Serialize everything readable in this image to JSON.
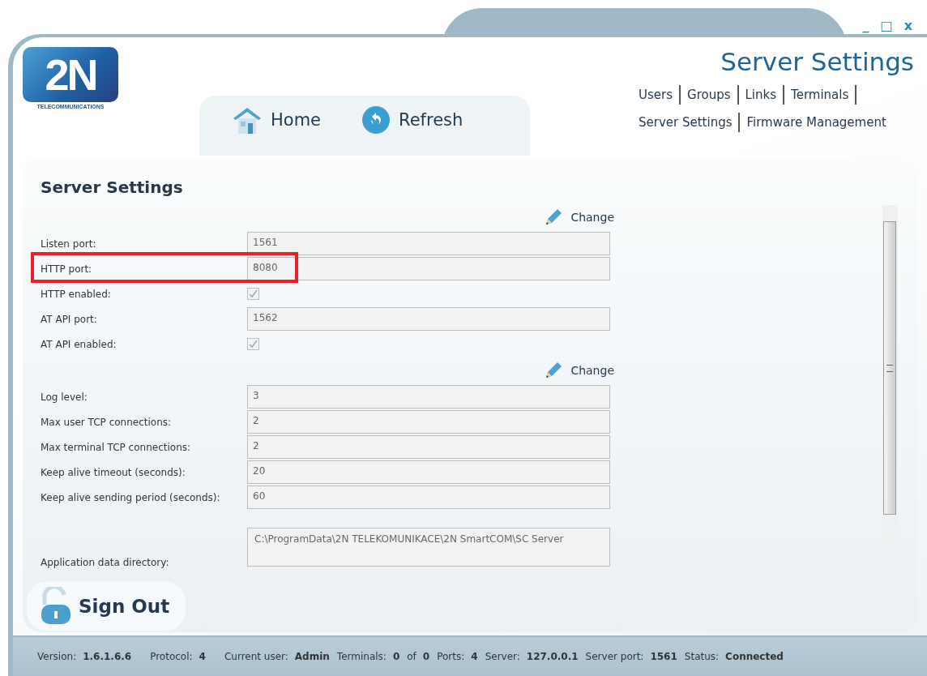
{
  "window": {
    "controls": [
      "_",
      "□",
      "x"
    ]
  },
  "logo": {
    "mark": "2N",
    "tagline": "TELECOMMUNICATIONS"
  },
  "toolbar": [
    {
      "label": "Home",
      "kind": "home"
    },
    {
      "label": "Refresh",
      "kind": "refresh"
    }
  ],
  "header": {
    "title": "Server Settings"
  },
  "nav": [
    [
      {
        "label": "Users"
      },
      {
        "label": "Groups"
      },
      {
        "label": "Links"
      },
      {
        "label": "Terminals"
      }
    ],
    [
      {
        "label": "Server Settings"
      },
      {
        "label": "Firmware Management"
      }
    ]
  ],
  "panel": {
    "title": "Server Settings",
    "sections": [
      {
        "action": "Change",
        "fields": [
          {
            "label": "Listen port:",
            "kind": "text",
            "value": "1561",
            "highlighted": false
          },
          {
            "label": "HTTP port:",
            "kind": "text",
            "value": "8080",
            "highlighted": true
          },
          {
            "label": "HTTP enabled:",
            "kind": "checkbox",
            "checked": true,
            "highlighted": false
          },
          {
            "label": "AT API port:",
            "kind": "text",
            "value": "1562",
            "highlighted": false
          },
          {
            "label": "AT API enabled:",
            "kind": "checkbox",
            "checked": true,
            "highlighted": false
          }
        ]
      },
      {
        "action": "Change",
        "fields": [
          {
            "label": "Log level:",
            "kind": "text",
            "value": "3",
            "highlighted": false
          },
          {
            "label": "Max user TCP connections:",
            "kind": "text",
            "value": "2",
            "highlighted": false
          },
          {
            "label": "Max terminal TCP connections:",
            "kind": "text",
            "value": "2",
            "highlighted": false
          },
          {
            "label": "Keep alive timeout (seconds):",
            "kind": "text",
            "value": "20",
            "highlighted": false
          },
          {
            "label": "Keep alive sending period (seconds):",
            "kind": "text",
            "value": "60",
            "highlighted": false
          },
          {
            "label": "Application data directory:",
            "kind": "multiline",
            "value": "C:\\ProgramData\\2N TELEKOMUNIKACE\\2N SmartCOM\\SC Server",
            "highlighted": false
          }
        ]
      }
    ]
  },
  "sign_out": {
    "label": "Sign Out"
  },
  "status_bar": [
    {
      "label": "Version:",
      "value": "1.6.1.6.6"
    },
    {
      "label": "Protocol:",
      "value": "4"
    },
    {
      "label": "Current user:",
      "value": "Admin"
    },
    {
      "label": "Terminals:",
      "value": "0"
    },
    {
      "label": "of",
      "value": "0"
    },
    {
      "label": "Ports:",
      "value": "4"
    },
    {
      "label": "Server:",
      "value": "127.0.0.1"
    },
    {
      "label": "Server port:",
      "value": "1561"
    },
    {
      "label": "Status:",
      "value": "Connected"
    }
  ]
}
